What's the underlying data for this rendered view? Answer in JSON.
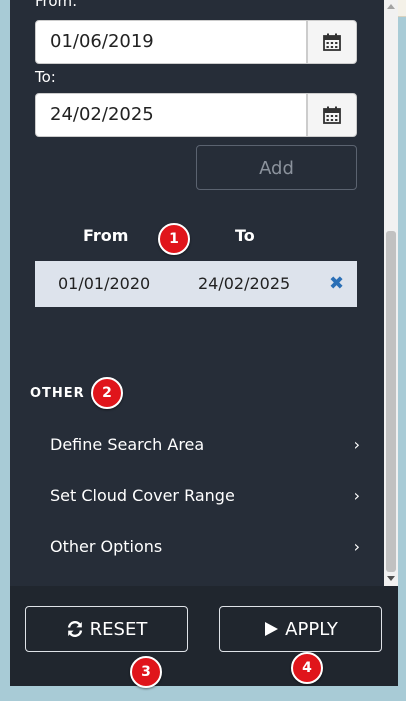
{
  "colors": {
    "panel_bg": "#262d38",
    "footer_bg": "#20262e",
    "badge_red": "#e0151b",
    "row_bg": "#dde3ec",
    "delete_blue": "#2a6fb6"
  },
  "date_filter": {
    "from_label": "From:",
    "from_value": "01/06/2019",
    "to_label": "To:",
    "to_value": "24/02/2025",
    "calendar_icon": "calendar-icon",
    "add_label": "Add"
  },
  "ranges": {
    "headers": {
      "from": "From",
      "to": "To"
    },
    "rows": [
      {
        "from": "01/01/2020",
        "to": "24/02/2025",
        "delete_icon": "✖"
      }
    ]
  },
  "other": {
    "title": "OTHER",
    "items": [
      {
        "label": "Define Search Area",
        "chevron": "›"
      },
      {
        "label": "Set Cloud Cover Range",
        "chevron": "›"
      },
      {
        "label": "Other Options",
        "chevron": "›"
      }
    ]
  },
  "footer": {
    "reset_label": "RESET",
    "apply_label": "APPLY"
  },
  "badges": [
    "1",
    "2",
    "3",
    "4"
  ]
}
